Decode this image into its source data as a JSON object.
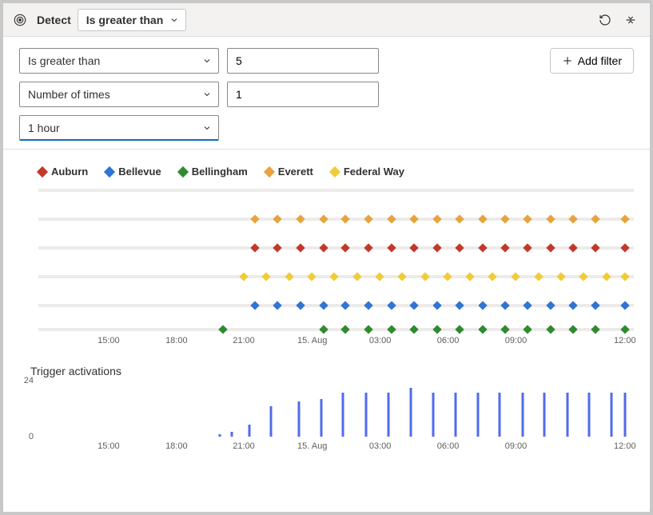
{
  "toolbar": {
    "label": "Detect",
    "dropdown": "Is greater than"
  },
  "config": {
    "condition": "Is greater than",
    "threshold": "5",
    "aggregation": "Number of times",
    "count": "1",
    "window": "1 hour",
    "add_filter": "Add filter"
  },
  "legend": [
    {
      "name": "Auburn",
      "color": "#c0392b"
    },
    {
      "name": "Bellevue",
      "color": "#2e75d4"
    },
    {
      "name": "Bellingham",
      "color": "#2e8b2e"
    },
    {
      "name": "Everett",
      "color": "#e8a33d"
    },
    {
      "name": "Federal Way",
      "color": "#f0cc3a"
    }
  ],
  "chart_data": [
    {
      "type": "scatter",
      "title": "",
      "xlabel": "",
      "ylabel": "",
      "x_ticks": [
        "15:00",
        "18:00",
        "21:00",
        "15. Aug",
        "03:00",
        "06:00",
        "09:00",
        "12:00"
      ],
      "x_tick_positions": [
        11.8,
        23.2,
        34.5,
        46.0,
        57.4,
        68.8,
        80.2,
        98.5
      ],
      "gridline_positions": [
        2,
        22,
        42,
        62,
        82,
        99
      ],
      "series": [
        {
          "name": "Everett",
          "color": "#e8a33d",
          "y": 22,
          "x": [
            36.4,
            40.2,
            44.0,
            47.9,
            51.6,
            55.5,
            59.3,
            63.1,
            67.0,
            70.8,
            74.6,
            78.4,
            82.2,
            86.0,
            89.8,
            93.6,
            98.5
          ]
        },
        {
          "name": "Auburn",
          "color": "#c0392b",
          "y": 42,
          "x": [
            36.4,
            40.2,
            44.0,
            47.9,
            51.6,
            55.5,
            59.3,
            63.1,
            67.0,
            70.8,
            74.6,
            78.4,
            82.2,
            86.0,
            89.8,
            93.6,
            98.5
          ]
        },
        {
          "name": "Federal Way",
          "color": "#f0cc3a",
          "y": 62,
          "x": [
            34.5,
            38.3,
            42.1,
            45.9,
            49.7,
            53.5,
            57.3,
            61.1,
            64.9,
            68.7,
            72.5,
            76.3,
            80.2,
            84.0,
            87.8,
            91.6,
            95.4,
            98.5
          ]
        },
        {
          "name": "Bellevue",
          "color": "#2e75d4",
          "y": 82,
          "x": [
            36.4,
            40.2,
            44.0,
            47.9,
            51.6,
            55.5,
            59.3,
            63.1,
            67.0,
            70.8,
            74.6,
            78.4,
            82.2,
            86.0,
            89.8,
            93.6,
            98.5
          ]
        },
        {
          "name": "Bellingham",
          "color": "#2e8b2e",
          "y": 99,
          "x": [
            31.0,
            47.9,
            51.6,
            55.5,
            59.3,
            63.1,
            67.0,
            70.8,
            74.6,
            78.4,
            82.2,
            86.0,
            89.8,
            93.6,
            98.5
          ]
        }
      ]
    },
    {
      "type": "bar",
      "title": "Trigger activations",
      "ylabel": "",
      "ylim": [
        0,
        24
      ],
      "y_ticks": [
        0,
        24
      ],
      "x_ticks": [
        "15:00",
        "18:00",
        "21:00",
        "15. Aug",
        "03:00",
        "06:00",
        "09:00",
        "12:00"
      ],
      "x_tick_positions": [
        11.8,
        23.2,
        34.5,
        46.0,
        57.4,
        68.8,
        80.2,
        98.5
      ],
      "bars": [
        {
          "x": 30.5,
          "v": 1
        },
        {
          "x": 32.5,
          "v": 2
        },
        {
          "x": 35.5,
          "v": 5
        },
        {
          "x": 39.0,
          "v": 13
        },
        {
          "x": 43.7,
          "v": 15
        },
        {
          "x": 47.5,
          "v": 16
        },
        {
          "x": 51.2,
          "v": 19
        },
        {
          "x": 55.0,
          "v": 19
        },
        {
          "x": 58.8,
          "v": 19
        },
        {
          "x": 62.5,
          "v": 21
        },
        {
          "x": 66.3,
          "v": 19
        },
        {
          "x": 70.0,
          "v": 19
        },
        {
          "x": 73.8,
          "v": 19
        },
        {
          "x": 77.5,
          "v": 19
        },
        {
          "x": 81.3,
          "v": 19
        },
        {
          "x": 85.0,
          "v": 19
        },
        {
          "x": 88.8,
          "v": 19
        },
        {
          "x": 92.5,
          "v": 19
        },
        {
          "x": 96.2,
          "v": 19
        },
        {
          "x": 98.5,
          "v": 19
        }
      ]
    }
  ]
}
